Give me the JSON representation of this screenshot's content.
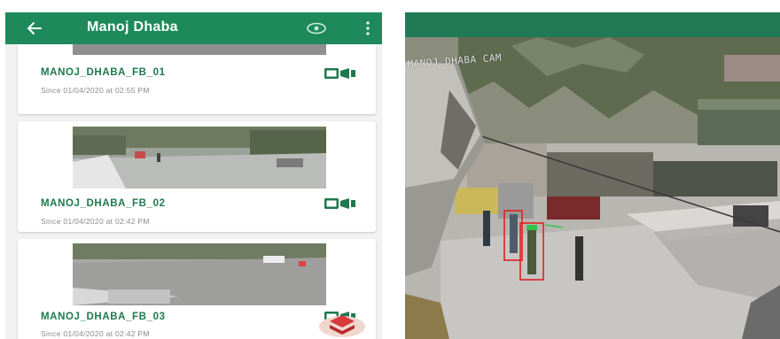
{
  "app": {
    "title": "Manoj Dhaba",
    "back_icon": "arrow-left-icon",
    "view_icon": "eye-icon",
    "menu_icon": "more-vert-icon",
    "theme_color": "#1e8a5c"
  },
  "cameras": [
    {
      "name": "MANOJ_DHABA_FB_01",
      "since": "Since 01/04/2020 at 02:55 PM",
      "status_icon": "camera-icon"
    },
    {
      "name": "MANOJ_DHABA_FB_02",
      "since": "Since 01/04/2020 at 02:42 PM",
      "status_icon": "camera-icon"
    },
    {
      "name": "MANOJ_DHABA_FB_03",
      "since": "Since 01/04/2020 at 02:42 PM",
      "status_icon": "camera-icon"
    }
  ],
  "fab": {
    "icon": "layers-icon",
    "color": "#e84040"
  },
  "feed": {
    "overlay_text": "MANOJ DHABA CAM",
    "bar_color": "#1f7a55",
    "detection_box_color": "#e02020"
  }
}
